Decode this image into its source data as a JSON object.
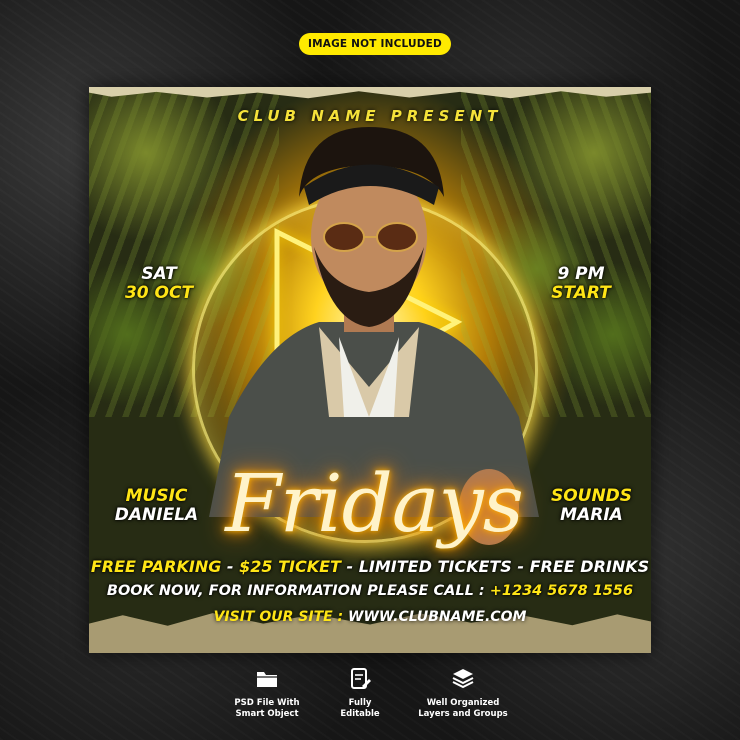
{
  "badge": "IMAGE NOT INCLUDED",
  "flyer": {
    "club_title": "CLUB NAME PRESENT",
    "left_top": {
      "line1": "SAT",
      "line2": "30 OCT"
    },
    "right_top": {
      "line1": "9 PM",
      "line2": "START"
    },
    "left_bottom": {
      "line1": "MUSIC",
      "line2": "DANIELA"
    },
    "right_bottom": {
      "line1": "SOUNDS",
      "line2": "MARIA"
    },
    "headline": "Fridays",
    "features": {
      "f1": "FREE PARKING",
      "sep1": " - ",
      "f2": "$25 TICKET",
      "sep2": " - ",
      "f3": "LIMITED TICKETS",
      "sep3": " - ",
      "f4": "FREE DRINKS"
    },
    "book_text": "BOOK NOW, FOR INFORMATION PLEASE CALL :",
    "phone": "+1234 5678 1556",
    "site_label": "VISIT OUR SITE :",
    "site_url": "WWW.CLUBNAME.COM"
  },
  "bottom_features": [
    {
      "icon": "folder-icon",
      "line1": "PSD File With",
      "line2": "Smart Object"
    },
    {
      "icon": "edit-document-icon",
      "line1": "Fully",
      "line2": "Editable"
    },
    {
      "icon": "layers-icon",
      "line1": "Well Organized",
      "line2": "Layers and Groups"
    }
  ],
  "colors": {
    "accent_yellow": "#ffe516",
    "badge_yellow": "#ffea00",
    "neon_orange": "#ff9900",
    "background_dark": "#161616"
  }
}
